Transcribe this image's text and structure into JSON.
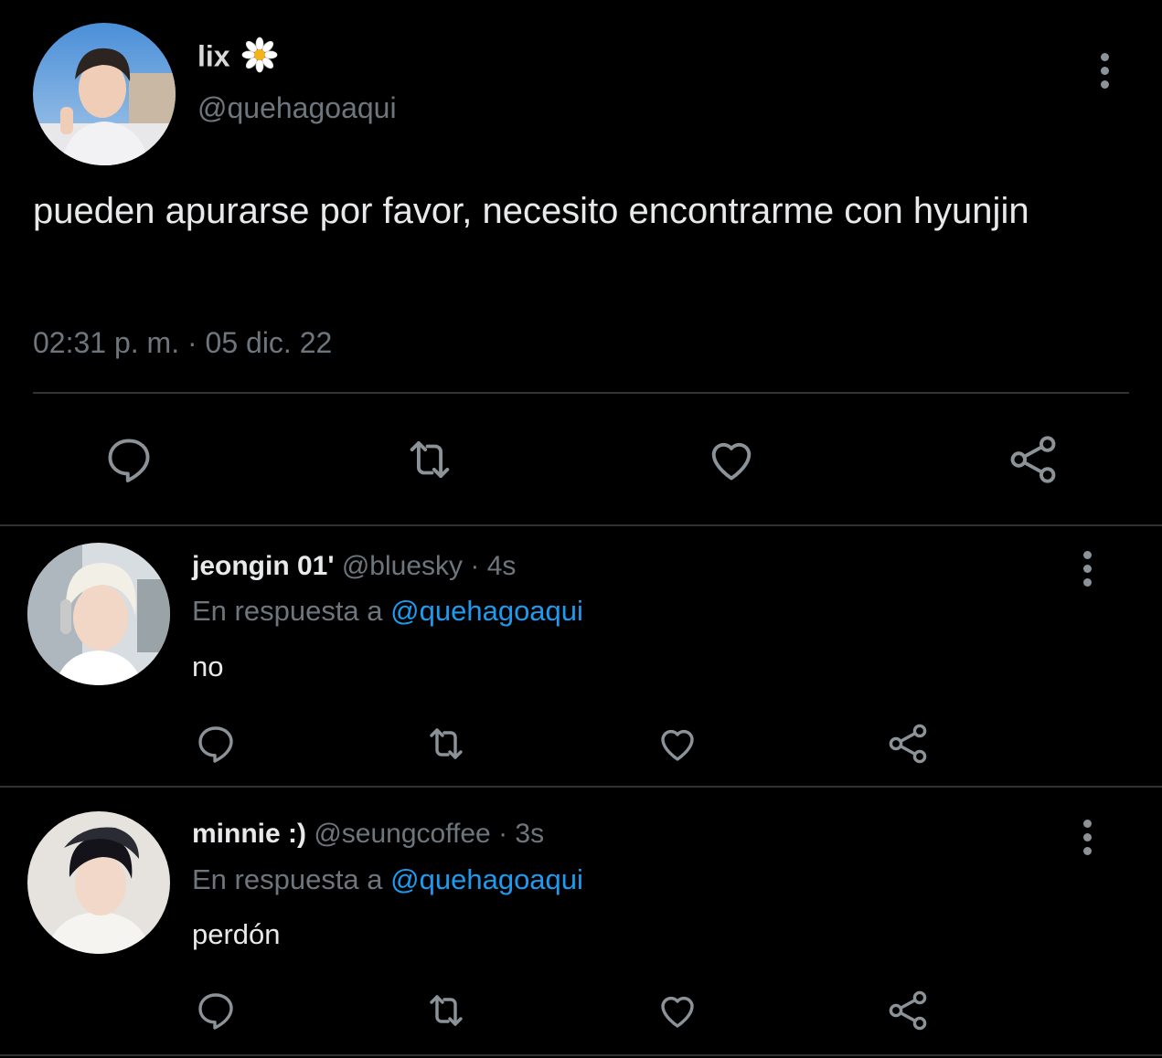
{
  "main_tweet": {
    "display_name": "lix",
    "name_emoji": "🌼",
    "handle": "@quehagoaqui",
    "text": "pueden apurarse por favor, necesito encontrarme con hyunjin",
    "timestamp": "02:31 p. m. · 05 dic. 22",
    "actions": [
      "reply-icon",
      "retweet-icon",
      "like-icon",
      "share-icon"
    ]
  },
  "replies": [
    {
      "display_name": "jeongin 01'",
      "handle": "@bluesky",
      "time": "· 4s",
      "reply_prefix": "En respuesta a",
      "reply_to": "@quehagoaqui",
      "text": "no"
    },
    {
      "display_name": "minnie :)",
      "handle": "@seungcoffee",
      "time": "· 3s",
      "reply_prefix": "En respuesta a",
      "reply_to": "@quehagoaqui",
      "text": "perdón"
    }
  ],
  "colors": {
    "background": "#000000",
    "text": "#e7e9ea",
    "secondary": "#6e767d",
    "link": "#1d9bf0",
    "divider": "#2f3336"
  }
}
